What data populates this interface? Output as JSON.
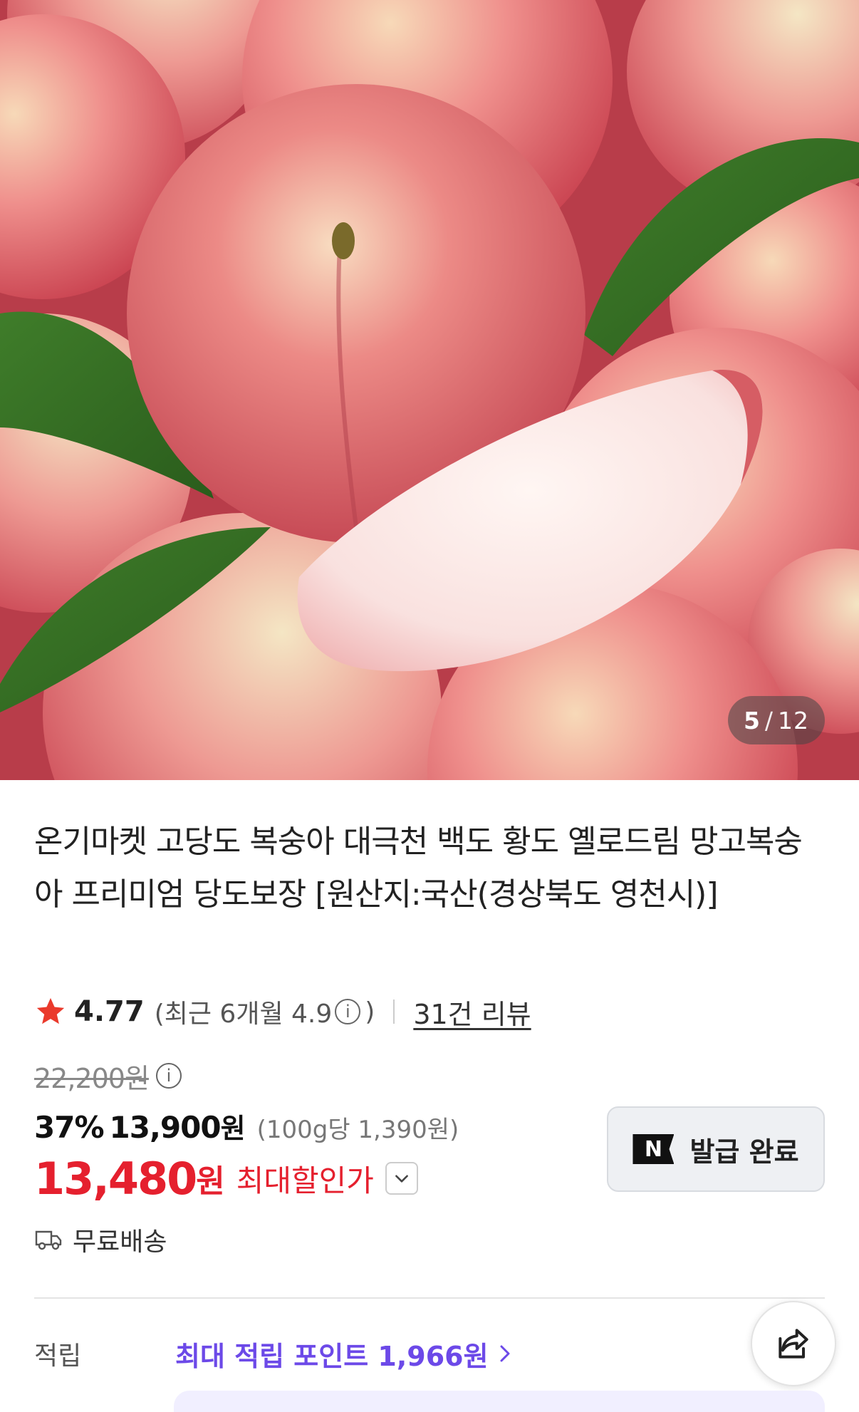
{
  "gallery": {
    "current": "5",
    "separator": "/",
    "total": "12"
  },
  "product": {
    "title": "온기마켓 고당도 복숭아 대극천 백도 황도 옐로드림 망고복숭아 프리미엄 당도보장 [원산지:국산(경상북도 영천시)]"
  },
  "rating": {
    "score": "4.77",
    "recent_prefix": "(최근 6개월 4.9",
    "recent_suffix": ")",
    "info_glyph": "i",
    "reviews": "31건 리뷰"
  },
  "price": {
    "original": "22,200원",
    "discount_rate": "37%",
    "sale": "13,900",
    "sale_unit": "원",
    "unit_price": "(100g당 1,390원)",
    "max_discount": "13,480",
    "max_unit": "원",
    "max_label": "최대할인가"
  },
  "coupon": {
    "badge": "N",
    "label": "발급 완료"
  },
  "shipping": {
    "label": "무료배송"
  },
  "points": {
    "label": "적립",
    "link": "최대 적립 포인트 1,966원"
  },
  "icons": {
    "star": "star-icon",
    "info": "info-icon",
    "chevron": "chevron-down-icon",
    "truck": "truck-icon",
    "share": "share-icon",
    "arrow": "chevron-right-icon"
  },
  "colors": {
    "sale_red": "#e5202e",
    "points_purple": "#6c49e8",
    "star": "#ea3a2c"
  }
}
